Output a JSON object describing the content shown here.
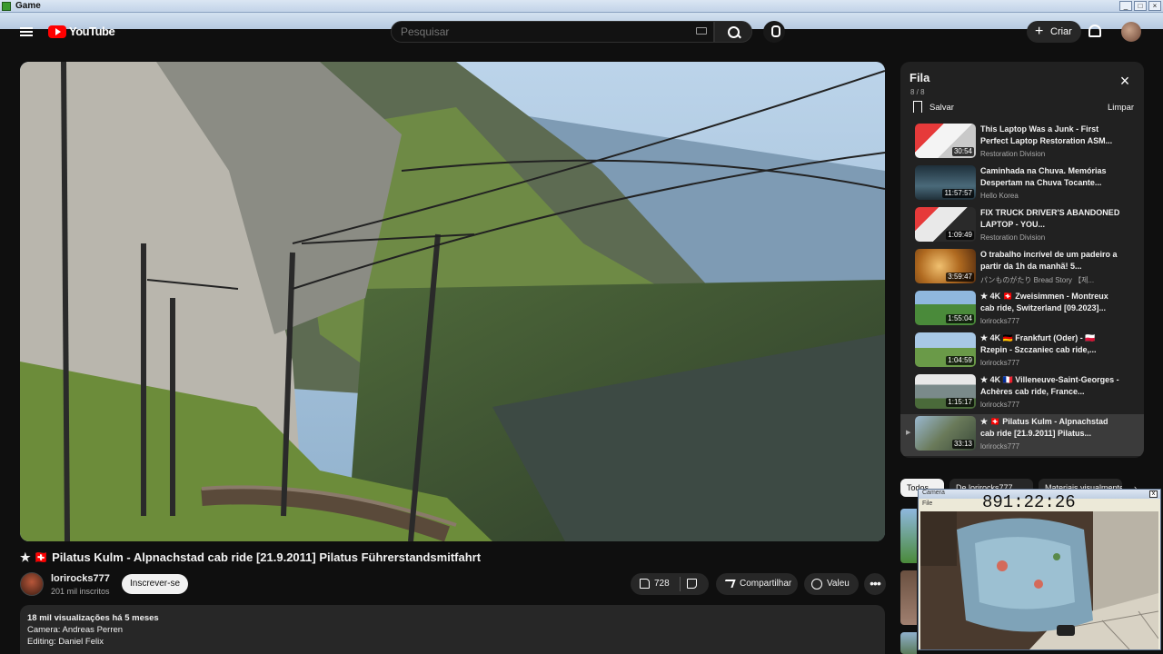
{
  "window": {
    "title": "Game",
    "controls": [
      "_",
      "□",
      "×"
    ]
  },
  "header": {
    "logo_text": "YouTube",
    "search_placeholder": "Pesquisar",
    "create_label": "Criar"
  },
  "video": {
    "title": "★ 🇨🇭 Pilatus Kulm - Alpnachstad cab ride [21.9.2011] Pilatus Führerstandsmitfahrt",
    "channel": "lorirocks777",
    "subscribers": "201 mil inscritos",
    "subscribe_label": "Inscrever-se",
    "likes": "728",
    "share_label": "Compartilhar",
    "thanks_label": "Valeu",
    "more_label": "•••",
    "description": {
      "stats": "18 mil visualizações  há 5 meses",
      "line1": "Camera: Andreas Perren",
      "line2": "Editing: Daniel Felix"
    }
  },
  "queue": {
    "title": "Fila",
    "count": "8 / 8",
    "save_label": "Salvar",
    "clear_label": "Limpar",
    "items": [
      {
        "title": "This Laptop Was a Junk - First Perfect Laptop Restoration ASM...",
        "channel": "Restoration Division",
        "duration": "30:54"
      },
      {
        "title": "Caminhada na Chuva. Memórias Despertam na Chuva Tocante...",
        "channel": "Hello Korea",
        "duration": "11:57:57"
      },
      {
        "title": "FIX TRUCK DRIVER'S ABANDONED LAPTOP - YOU...",
        "channel": "Restoration Division",
        "duration": "1:09:49"
      },
      {
        "title": "O trabalho incrível de um padeiro a partir da 1h da manhã! 5...",
        "channel": "パンものがたり Bread Story 【제...",
        "duration": "3:59:47"
      },
      {
        "title": "★ 4K 🇨🇭 Zweisimmen - Montreux cab ride, Switzerland [09.2023]...",
        "channel": "lorirocks777",
        "duration": "1:55:04"
      },
      {
        "title": "★ 4K 🇩🇪 Frankfurt (Oder) - 🇵🇱 Rzepin - Szczaniec cab ride,...",
        "channel": "lorirocks777",
        "duration": "1:04:59"
      },
      {
        "title": "★ 4K 🇫🇷 Villeneuve-Saint-Georges - Achères cab ride, France...",
        "channel": "lorirocks777",
        "duration": "1:15:17"
      },
      {
        "title": "★ 🇨🇭 Pilatus Kulm - Alpnachstad cab ride [21.9.2011] Pilatus...",
        "channel": "lorirocks777",
        "duration": "33:13",
        "playing_marker": "▶"
      }
    ]
  },
  "chips": [
    "Todos",
    "De lorirocks777",
    "Materiais visualmente..."
  ],
  "overlay": {
    "title": "Camera",
    "menu": "File",
    "clock": "891:22:26",
    "close": "x"
  },
  "colors": {
    "accent": "#ff0000",
    "background": "#0f0f0f",
    "panel": "#212121"
  }
}
